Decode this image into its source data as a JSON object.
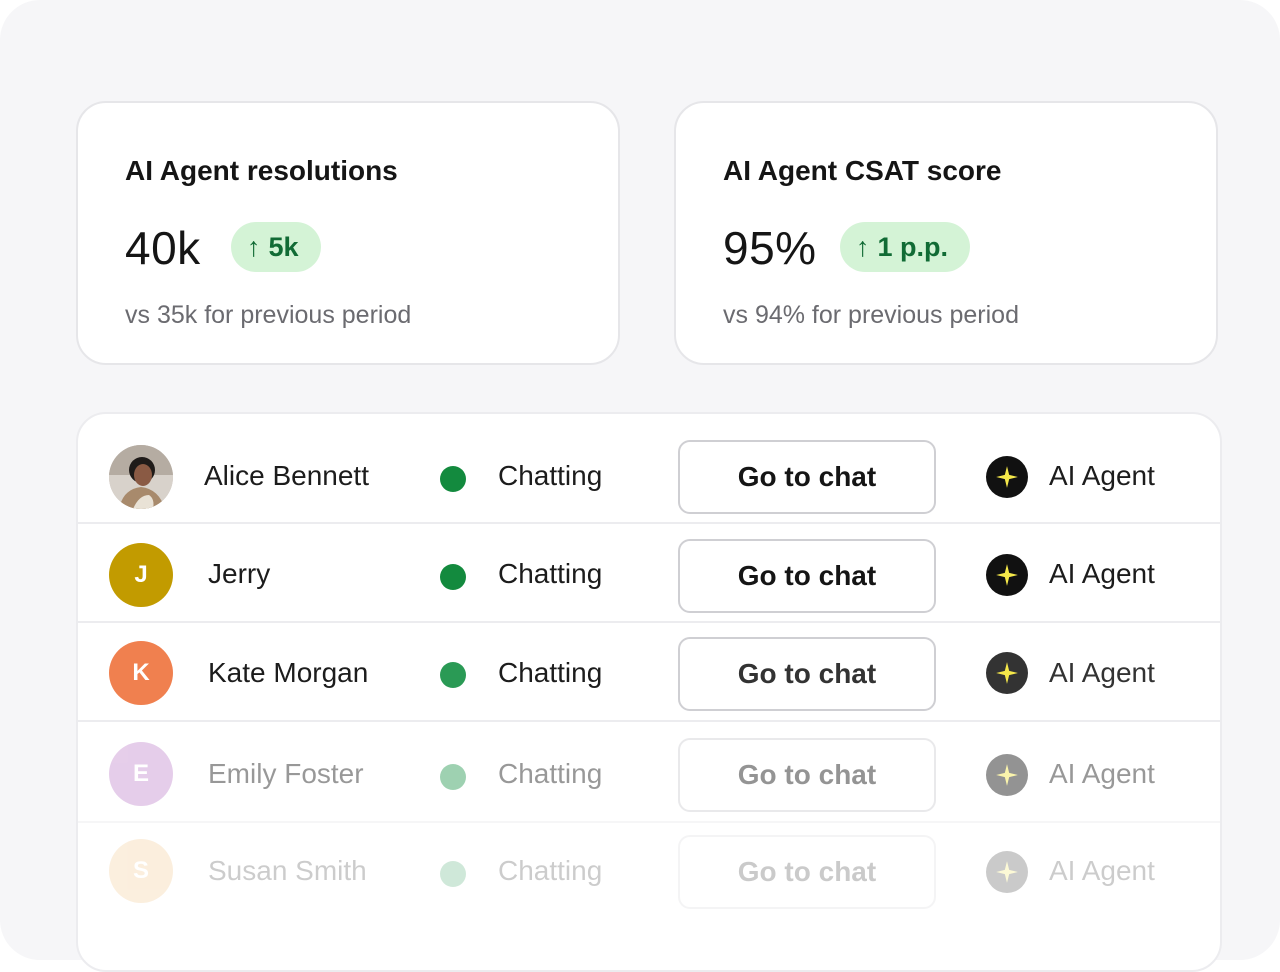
{
  "cards": [
    {
      "title": "AI Agent resolutions",
      "value": "40k",
      "delta_arrow": "↑",
      "delta": "5k",
      "comparison": "vs 35k for previous period"
    },
    {
      "title": "AI Agent CSAT score",
      "value": "95%",
      "delta_arrow": "↑",
      "delta": "1 p.p.",
      "comparison": "vs 94% for previous period"
    }
  ],
  "conversations": [
    {
      "name": "Alice Bennett",
      "initial": "",
      "avatar_color": "#b9a99a",
      "status": "Chatting",
      "action": "Go to chat",
      "assignee": "AI Agent"
    },
    {
      "name": "Jerry",
      "initial": "J",
      "avatar_color": "#c29b00",
      "status": "Chatting",
      "action": "Go to chat",
      "assignee": "AI Agent"
    },
    {
      "name": "Kate Morgan",
      "initial": "K",
      "avatar_color": "#f0804f",
      "status": "Chatting",
      "action": "Go to chat",
      "assignee": "AI Agent"
    },
    {
      "name": "Emily Foster",
      "initial": "E",
      "avatar_color": "#d6b1dd",
      "status": "Chatting",
      "action": "Go to chat",
      "assignee": "AI Agent"
    },
    {
      "name": "Susan Smith",
      "initial": "S",
      "avatar_color": "#f6ddb8",
      "status": "Chatting",
      "action": "Go to chat",
      "assignee": "AI Agent"
    }
  ],
  "colors": {
    "status_dot": "#138a3e",
    "badge_bg": "#d4f3d6",
    "badge_text": "#116b35",
    "sparkle": "#f5e84a"
  },
  "icons": {
    "assignee": "sparkle-icon",
    "delta": "arrow-up-icon",
    "status": "status-dot"
  }
}
